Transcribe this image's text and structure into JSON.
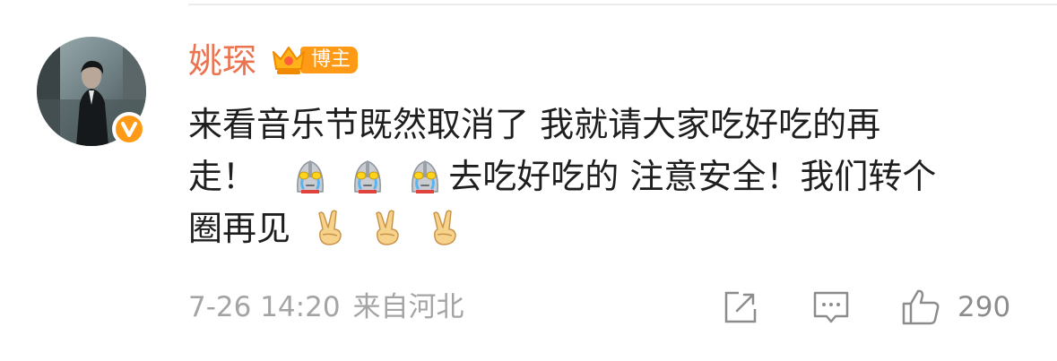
{
  "comment": {
    "author": "姚琛",
    "badge_label": "博主",
    "line1": "来看音乐节既然取消了 我就请大家吃好吃的再",
    "line2_start": "走！",
    "line2_end": "去吃好吃的 注意安全！我们转个",
    "line3": "圈再见",
    "emoji_names": [
      "ultraman-crying",
      "victory-hand"
    ],
    "date": "7-26 14:20",
    "source": "来自河北",
    "like_count": "290"
  },
  "colors": {
    "author": "#eb7350",
    "badge": "#ff9a17",
    "text": "#1e1e1e",
    "meta": "#a4a4a4",
    "icon": "#8c8c8c"
  }
}
